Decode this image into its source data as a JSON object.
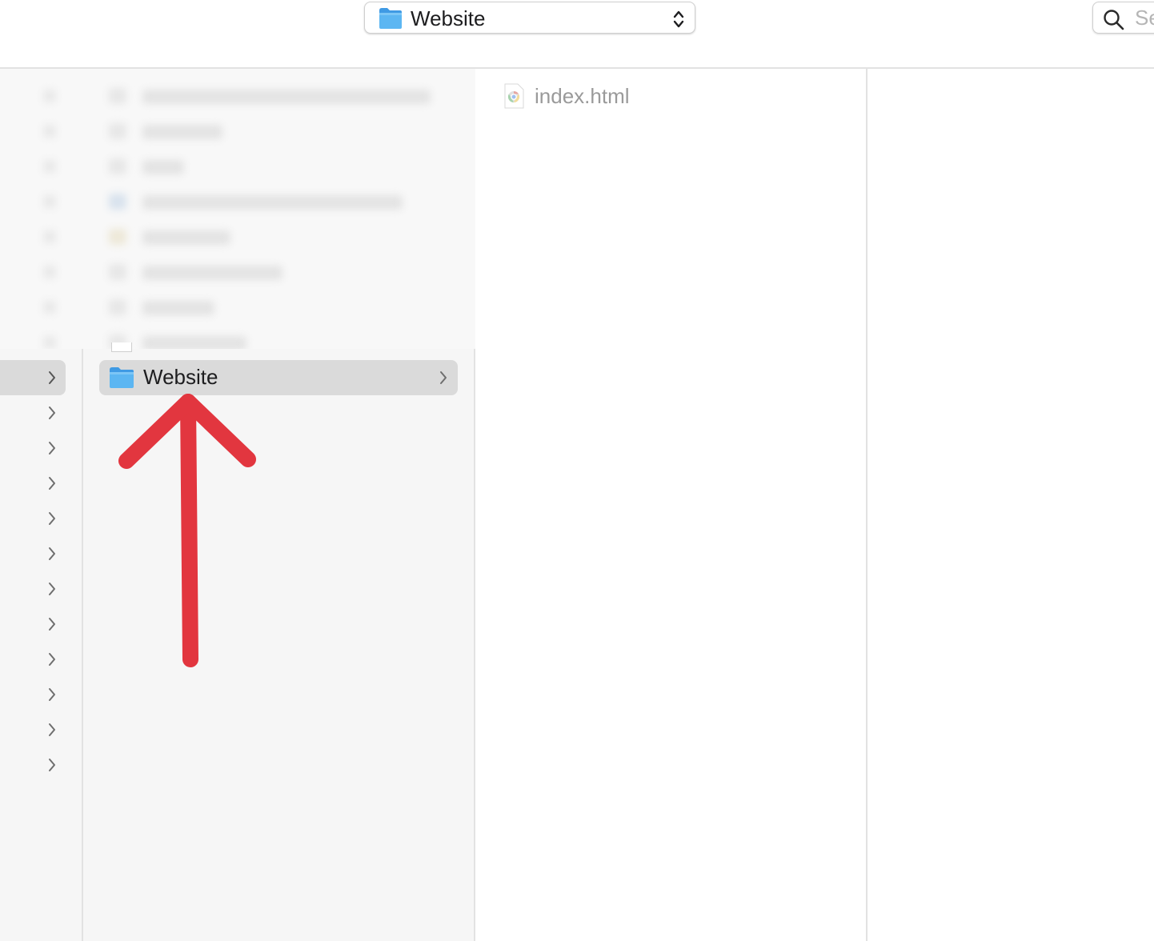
{
  "toolbar": {
    "path_popup": {
      "title": "Website",
      "folder_icon": "folder-icon",
      "stepper_icon": "up-down-chevron-icon"
    },
    "search": {
      "icon": "magnifying-glass-icon",
      "placeholder": "Search"
    }
  },
  "columns": {
    "column1": {
      "chevron_icon": "chevron-right-icon",
      "row_count": 12,
      "selected_row": 1
    },
    "column2": {
      "obscured_items_note": "",
      "selected_item": {
        "name": "Website",
        "icon": "folder-icon",
        "chevron": "chevron-right-icon"
      }
    },
    "column3": {
      "items": [
        {
          "name": "index.html",
          "icon": "chrome-html-document-icon"
        }
      ]
    }
  },
  "annotation": {
    "type": "arrow",
    "color": "#e2363f",
    "points_to": "Website"
  },
  "colors": {
    "selection": "#dadada",
    "sidebar_bg": "#f6f6f6",
    "folder_blue": "#5ab4f0",
    "arrow_red": "#e2363f"
  }
}
